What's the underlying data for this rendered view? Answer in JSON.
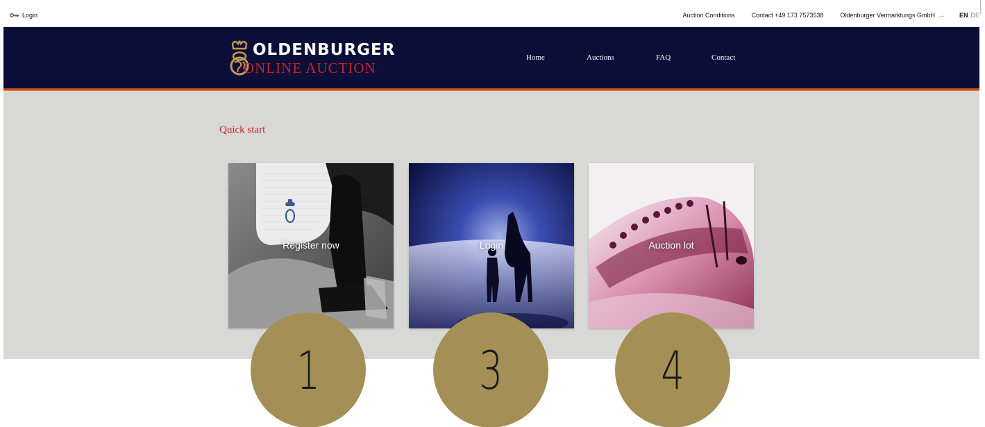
{
  "topbar": {
    "login": "Login",
    "links": {
      "conditions": "Auction Conditions",
      "contact": "Contact +49 173 7573538",
      "company": "Oldenburger Vermarktungs GmbH"
    },
    "lang_en": "EN",
    "lang_de": "DE"
  },
  "logo": {
    "brand": "OLDENBURGER",
    "sub": "ONLINE AUCTION"
  },
  "nav": {
    "home": "Home",
    "auctions": "Auctions",
    "faq": "FAQ",
    "contact": "Contact"
  },
  "quickstart": {
    "title": "Quick start",
    "cards": [
      {
        "label": "Register now"
      },
      {
        "label": "Login"
      },
      {
        "label": "Auction lot"
      }
    ]
  },
  "badges": [
    "1",
    "3",
    "4"
  ],
  "colors": {
    "navy": "#0b0f38",
    "accent_red": "#c8202c",
    "gold_badge": "#a48f56",
    "content_grey": "#d8d8d6"
  },
  "icons": {
    "login": "key-icon",
    "company": "arrow-right-icon"
  }
}
